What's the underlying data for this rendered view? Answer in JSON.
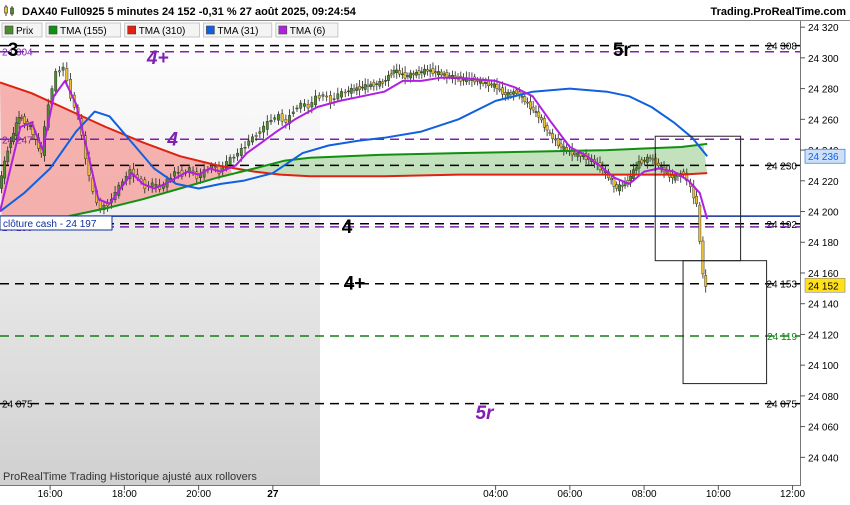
{
  "header": {
    "left": "DAX40 Full0925 5 minutes 24 152 -0,31 % 27 août 2025, 09:24:54",
    "right": "Trading.ProRealTime.com"
  },
  "legend": [
    {
      "label": "Prix",
      "color": "#4c8c2c",
      "icon": "candle-icon"
    },
    {
      "label": "TMA (155)",
      "color": "#109010"
    },
    {
      "label": "TMA (310)",
      "color": "#e02010"
    },
    {
      "label": "TMA (31)",
      "color": "#1060e0"
    },
    {
      "label": "TMA (6)",
      "color": "#b020e0"
    }
  ],
  "footer": "ProRealTime Trading  Historique ajusté aux rollovers",
  "cash_label": "clôture cash -  24 197",
  "chart_data": {
    "type": "line",
    "title": "DAX40 Full0925 5 minutes",
    "ylim": [
      24022,
      24324
    ],
    "xlim_hours": [
      14.65,
      36.2
    ],
    "yticks": [
      24040,
      24060,
      24080,
      24100,
      24120,
      24140,
      24160,
      24180,
      24200,
      24220,
      24240,
      24260,
      24280,
      24300,
      24320
    ],
    "xticks": [
      {
        "h": 16,
        "label": "16:00"
      },
      {
        "h": 18,
        "label": "18:00"
      },
      {
        "h": 20,
        "label": "20:00"
      },
      {
        "h": 22,
        "label": "27"
      },
      {
        "h": 28,
        "label": "04:00"
      },
      {
        "h": 30,
        "label": "06:00"
      },
      {
        "h": 32,
        "label": "08:00"
      },
      {
        "h": 34,
        "label": "10:00"
      },
      {
        "h": 36,
        "label": "12:00"
      }
    ],
    "levels": [
      {
        "value": 24308,
        "style": "dash",
        "color": "#000000",
        "left_label": "",
        "right_label": "24 308"
      },
      {
        "value": 24304,
        "style": "dash",
        "color": "#8020b0",
        "left_label": "24 304",
        "right_label": ""
      },
      {
        "value": 24247,
        "style": "dash",
        "color": "#8020b0",
        "left_label": "24 247",
        "right_label": ""
      },
      {
        "value": 24230,
        "style": "dash",
        "color": "#000000",
        "left_label": "",
        "right_label": "24 230"
      },
      {
        "value": 24197,
        "style": "solid",
        "color": "#1030a0",
        "left_label": "",
        "right_label": ""
      },
      {
        "value": 24192,
        "style": "dash",
        "color": "#000000",
        "left_label": "",
        "right_label": "24 192"
      },
      {
        "value": 24190,
        "style": "dash",
        "color": "#8020b0",
        "left_label": "24 190",
        "right_label": ""
      },
      {
        "value": 24153,
        "style": "dash",
        "color": "#000000",
        "left_label": "",
        "right_label": "24 153"
      },
      {
        "value": 24119,
        "style": "dash",
        "color": "#108010",
        "left_label": "",
        "right_label": "24 119"
      },
      {
        "value": 24075,
        "style": "dash",
        "color": "#000000",
        "left_label": "24 075",
        "right_label": "24 075"
      }
    ],
    "annotations": [
      {
        "text": "3",
        "h": 15.0,
        "y": 24305,
        "color": "#000000"
      },
      {
        "text": "4+",
        "h": 18.9,
        "y": 24300,
        "color": "#8020b0"
      },
      {
        "text": "5r",
        "h": 31.4,
        "y": 24305,
        "color": "#000000"
      },
      {
        "text": "4",
        "h": 19.3,
        "y": 24247,
        "color": "#8020b0"
      },
      {
        "text": "4",
        "h": 24.0,
        "y": 24190,
        "color": "#000000"
      },
      {
        "text": "4+",
        "h": 24.2,
        "y": 24153,
        "color": "#000000"
      },
      {
        "text": "5r",
        "h": 27.7,
        "y": 24069,
        "color": "#8020b0"
      }
    ],
    "boxes": [
      {
        "h1": 32.3,
        "h2": 34.6,
        "y1": 24249,
        "y2": 24168
      },
      {
        "h1": 33.05,
        "h2": 35.3,
        "y1": 24168,
        "y2": 24088
      }
    ],
    "current_price": {
      "value": 24152,
      "label": "24 152"
    },
    "tma31_value_label": "24 236",
    "series": [
      {
        "name": "TMA (310)",
        "color": "#e02010",
        "points": [
          [
            14.65,
            24284
          ],
          [
            15.5,
            24277
          ],
          [
            16.5,
            24266
          ],
          [
            17.5,
            24255
          ],
          [
            18.5,
            24245
          ],
          [
            19.5,
            24236
          ],
          [
            20.5,
            24230
          ],
          [
            21.5,
            24226
          ],
          [
            22.2,
            24224
          ],
          [
            23,
            24223
          ],
          [
            25,
            24223
          ],
          [
            27,
            24224
          ],
          [
            29,
            24224
          ],
          [
            31,
            24224
          ],
          [
            32,
            24224
          ],
          [
            33,
            24224
          ],
          [
            33.7,
            24225
          ]
        ]
      },
      {
        "name": "TMA (155)",
        "color": "#109010",
        "points": [
          [
            16.5,
            24197
          ],
          [
            17.5,
            24202
          ],
          [
            18.5,
            24208
          ],
          [
            19.5,
            24215
          ],
          [
            20.5,
            24222
          ],
          [
            21.5,
            24228
          ],
          [
            22.3,
            24233
          ],
          [
            23,
            24235
          ],
          [
            25,
            24237
          ],
          [
            27,
            24238
          ],
          [
            29,
            24239
          ],
          [
            31,
            24240
          ],
          [
            32,
            24241
          ],
          [
            33,
            24242
          ],
          [
            33.7,
            24244
          ]
        ]
      },
      {
        "name": "TMA (31)",
        "color": "#1060e0",
        "points": [
          [
            14.65,
            24200
          ],
          [
            15.3,
            24212
          ],
          [
            16,
            24228
          ],
          [
            16.7,
            24252
          ],
          [
            17.2,
            24265
          ],
          [
            17.6,
            24262
          ],
          [
            18.2,
            24245
          ],
          [
            18.8,
            24228
          ],
          [
            19.4,
            24218
          ],
          [
            20,
            24215
          ],
          [
            20.6,
            24218
          ],
          [
            21.2,
            24220
          ],
          [
            22,
            24225
          ],
          [
            22.8,
            24238
          ],
          [
            23.5,
            24243
          ],
          [
            24.3,
            24246
          ],
          [
            25,
            24248
          ],
          [
            26,
            24252
          ],
          [
            27,
            24260
          ],
          [
            28,
            24272
          ],
          [
            29,
            24278
          ],
          [
            30,
            24280
          ],
          [
            31,
            24278
          ],
          [
            31.6,
            24275
          ],
          [
            32.2,
            24268
          ],
          [
            32.8,
            24258
          ],
          [
            33.3,
            24248
          ],
          [
            33.7,
            24236
          ]
        ]
      },
      {
        "name": "TMA (6)",
        "color": "#b020e0",
        "points": [
          [
            14.65,
            24200
          ],
          [
            14.9,
            24225
          ],
          [
            15.2,
            24255
          ],
          [
            15.5,
            24258
          ],
          [
            15.8,
            24240
          ],
          [
            16.1,
            24275
          ],
          [
            16.4,
            24285
          ],
          [
            16.7,
            24270
          ],
          [
            17.0,
            24240
          ],
          [
            17.3,
            24208
          ],
          [
            17.6,
            24205
          ],
          [
            17.9,
            24215
          ],
          [
            18.2,
            24225
          ],
          [
            18.5,
            24218
          ],
          [
            18.8,
            24215
          ],
          [
            19.1,
            24218
          ],
          [
            19.4,
            24222
          ],
          [
            19.7,
            24226
          ],
          [
            20.0,
            24224
          ],
          [
            20.3,
            24228
          ],
          [
            20.6,
            24226
          ],
          [
            21.0,
            24230
          ],
          [
            21.3,
            24238
          ],
          [
            21.7,
            24245
          ],
          [
            22.1,
            24252
          ],
          [
            22.6,
            24260
          ],
          [
            23.2,
            24268
          ],
          [
            23.8,
            24272
          ],
          [
            24.4,
            24275
          ],
          [
            25,
            24278
          ],
          [
            25.5,
            24285
          ],
          [
            26,
            24285
          ],
          [
            26.5,
            24287
          ],
          [
            27,
            24287
          ],
          [
            27.5,
            24286
          ],
          [
            28.0,
            24285
          ],
          [
            28.5,
            24281
          ],
          [
            29.0,
            24275
          ],
          [
            29.5,
            24258
          ],
          [
            30.0,
            24242
          ],
          [
            30.4,
            24237
          ],
          [
            30.8,
            24230
          ],
          [
            31.2,
            24222
          ],
          [
            31.6,
            24218
          ],
          [
            32.0,
            24226
          ],
          [
            32.4,
            24228
          ],
          [
            32.8,
            24226
          ],
          [
            33.2,
            24220
          ],
          [
            33.5,
            24212
          ],
          [
            33.7,
            24195
          ]
        ]
      }
    ],
    "price": [
      [
        14.65,
        24215
      ],
      [
        14.9,
        24240
      ],
      [
        15.2,
        24262
      ],
      [
        15.5,
        24255
      ],
      [
        15.8,
        24238
      ],
      [
        16.0,
        24270
      ],
      [
        16.2,
        24290
      ],
      [
        16.4,
        24294
      ],
      [
        16.6,
        24275
      ],
      [
        16.8,
        24262
      ],
      [
        17.0,
        24235
      ],
      [
        17.2,
        24212
      ],
      [
        17.4,
        24202
      ],
      [
        17.6,
        24205
      ],
      [
        17.8,
        24212
      ],
      [
        18.0,
        24220
      ],
      [
        18.2,
        24226
      ],
      [
        18.4,
        24222
      ],
      [
        18.6,
        24216
      ],
      [
        18.8,
        24218
      ],
      [
        19.0,
        24215
      ],
      [
        19.2,
        24220
      ],
      [
        19.4,
        24226
      ],
      [
        19.6,
        24224
      ],
      [
        19.8,
        24228
      ],
      [
        20.0,
        24222
      ],
      [
        20.2,
        24226
      ],
      [
        20.4,
        24230
      ],
      [
        20.6,
        24226
      ],
      [
        20.8,
        24232
      ],
      [
        21.0,
        24236
      ],
      [
        21.2,
        24240
      ],
      [
        21.4,
        24246
      ],
      [
        21.6,
        24250
      ],
      [
        21.8,
        24255
      ],
      [
        22.0,
        24260
      ],
      [
        22.2,
        24262
      ],
      [
        22.4,
        24258
      ],
      [
        22.6,
        24266
      ],
      [
        22.8,
        24270
      ],
      [
        23.0,
        24268
      ],
      [
        23.2,
        24274
      ],
      [
        23.4,
        24276
      ],
      [
        23.6,
        24272
      ],
      [
        23.8,
        24276
      ],
      [
        24.0,
        24278
      ],
      [
        24.3,
        24280
      ],
      [
        24.6,
        24282
      ],
      [
        25.0,
        24284
      ],
      [
        25.3,
        24292
      ],
      [
        25.6,
        24288
      ],
      [
        25.9,
        24290
      ],
      [
        26.2,
        24292
      ],
      [
        26.5,
        24290
      ],
      [
        26.8,
        24288
      ],
      [
        27.1,
        24286
      ],
      [
        27.4,
        24286
      ],
      [
        27.7,
        24284
      ],
      [
        28.0,
        24282
      ],
      [
        28.3,
        24276
      ],
      [
        28.6,
        24278
      ],
      [
        28.9,
        24270
      ],
      [
        29.2,
        24262
      ],
      [
        29.5,
        24250
      ],
      [
        29.8,
        24242
      ],
      [
        30.1,
        24238
      ],
      [
        30.4,
        24236
      ],
      [
        30.7,
        24232
      ],
      [
        31.0,
        24225
      ],
      [
        31.3,
        24215
      ],
      [
        31.6,
        24220
      ],
      [
        31.9,
        24232
      ],
      [
        32.2,
        24235
      ],
      [
        32.5,
        24228
      ],
      [
        32.8,
        24222
      ],
      [
        33.1,
        24225
      ],
      [
        33.3,
        24215
      ],
      [
        33.45,
        24205
      ],
      [
        33.55,
        24180
      ],
      [
        33.62,
        24160
      ],
      [
        33.7,
        24150
      ]
    ]
  }
}
